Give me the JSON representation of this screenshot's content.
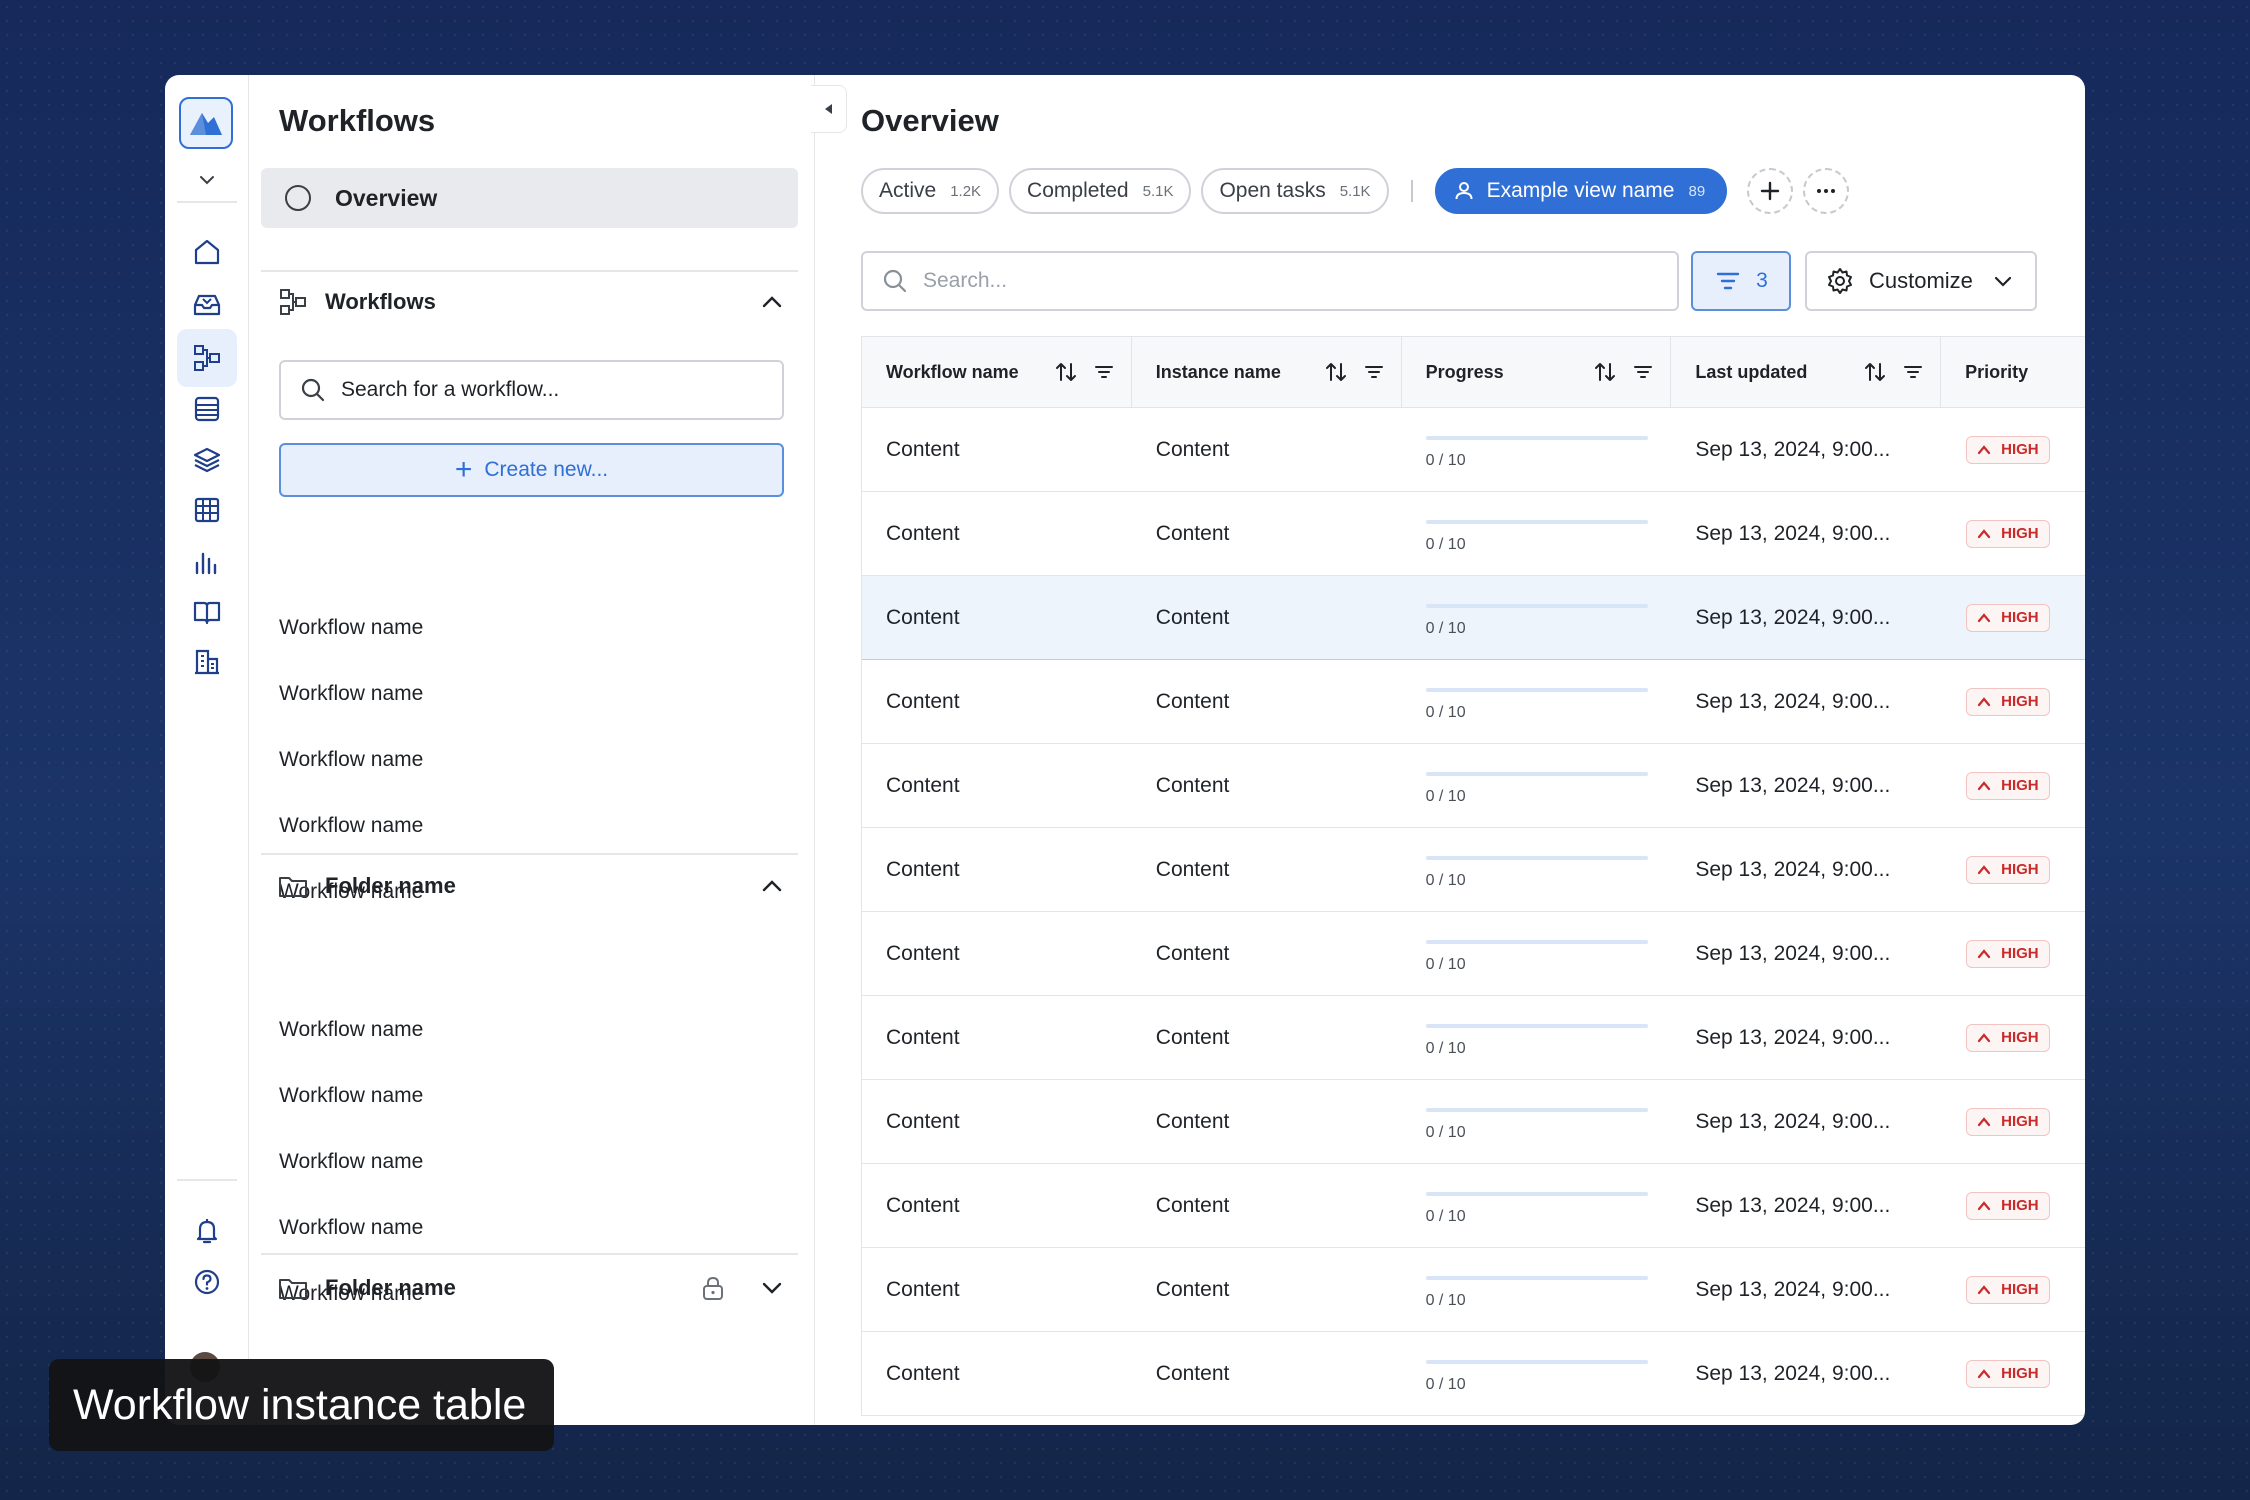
{
  "colors": {
    "accent": "#2f6fd6",
    "priority_high": "#c92a2a"
  },
  "rail": {
    "items": [
      {
        "name": "home-icon"
      },
      {
        "name": "inbox-icon"
      },
      {
        "name": "workflows-icon",
        "active": true
      },
      {
        "name": "list-icon"
      },
      {
        "name": "layers-icon"
      },
      {
        "name": "table-icon"
      },
      {
        "name": "chart-icon"
      },
      {
        "name": "book-icon"
      },
      {
        "name": "building-icon"
      }
    ],
    "bottom": [
      {
        "name": "bell-icon"
      },
      {
        "name": "help-icon"
      }
    ]
  },
  "sidebar": {
    "title": "Workflows",
    "overview_label": "Overview",
    "group_workflows": "Workflows",
    "search_placeholder": "Search for a workflow...",
    "create_label": "Create new...",
    "workflows": [
      "Workflow name",
      "Workflow name",
      "Workflow name",
      "Workflow name",
      "Workflow name"
    ],
    "folder1": {
      "label": "Folder name",
      "items": [
        "Workflow name",
        "Workflow name",
        "Workflow name",
        "Workflow name",
        "Workflow name"
      ]
    },
    "folder2": {
      "label": "Folder name"
    }
  },
  "main": {
    "title": "Overview",
    "chips": [
      {
        "label": "Active",
        "count": "1.2K"
      },
      {
        "label": "Completed",
        "count": "5.1K"
      },
      {
        "label": "Open tasks",
        "count": "5.1K"
      }
    ],
    "chip_separator": "|",
    "view_chip": {
      "label": "Example view name",
      "count": "89"
    },
    "search_placeholder": "Search...",
    "filter_count": "3",
    "customize_label": "Customize"
  },
  "table": {
    "headers": [
      "Workflow name",
      "Instance name",
      "Progress",
      "Last updated",
      "Priority"
    ],
    "rows": [
      {
        "workflow": "Content",
        "instance": "Content",
        "progress": "0 / 10",
        "progress_fraction": 0,
        "updated": "Sep 13, 2024, 9:00...",
        "priority": "HIGH"
      },
      {
        "workflow": "Content",
        "instance": "Content",
        "progress": "0 / 10",
        "progress_fraction": 0,
        "updated": "Sep 13, 2024, 9:00...",
        "priority": "HIGH"
      },
      {
        "workflow": "Content",
        "instance": "Content",
        "progress": "0 / 10",
        "progress_fraction": 0,
        "updated": "Sep 13, 2024, 9:00...",
        "priority": "HIGH",
        "highlighted": true
      },
      {
        "workflow": "Content",
        "instance": "Content",
        "progress": "0 / 10",
        "progress_fraction": 0,
        "updated": "Sep 13, 2024, 9:00...",
        "priority": "HIGH"
      },
      {
        "workflow": "Content",
        "instance": "Content",
        "progress": "0 / 10",
        "progress_fraction": 0,
        "updated": "Sep 13, 2024, 9:00...",
        "priority": "HIGH"
      },
      {
        "workflow": "Content",
        "instance": "Content",
        "progress": "0 / 10",
        "progress_fraction": 0,
        "updated": "Sep 13, 2024, 9:00...",
        "priority": "HIGH"
      },
      {
        "workflow": "Content",
        "instance": "Content",
        "progress": "0 / 10",
        "progress_fraction": 0,
        "updated": "Sep 13, 2024, 9:00...",
        "priority": "HIGH"
      },
      {
        "workflow": "Content",
        "instance": "Content",
        "progress": "0 / 10",
        "progress_fraction": 0,
        "updated": "Sep 13, 2024, 9:00...",
        "priority": "HIGH"
      },
      {
        "workflow": "Content",
        "instance": "Content",
        "progress": "0 / 10",
        "progress_fraction": 0,
        "updated": "Sep 13, 2024, 9:00...",
        "priority": "HIGH"
      },
      {
        "workflow": "Content",
        "instance": "Content",
        "progress": "0 / 10",
        "progress_fraction": 0,
        "updated": "Sep 13, 2024, 9:00...",
        "priority": "HIGH"
      },
      {
        "workflow": "Content",
        "instance": "Content",
        "progress": "0 / 10",
        "progress_fraction": 0,
        "updated": "Sep 13, 2024, 9:00...",
        "priority": "HIGH"
      },
      {
        "workflow": "Content",
        "instance": "Content",
        "progress": "0 / 10",
        "progress_fraction": 0,
        "updated": "Sep 13, 2024, 9:00...",
        "priority": "HIGH"
      }
    ]
  },
  "caption": "Workflow instance table"
}
